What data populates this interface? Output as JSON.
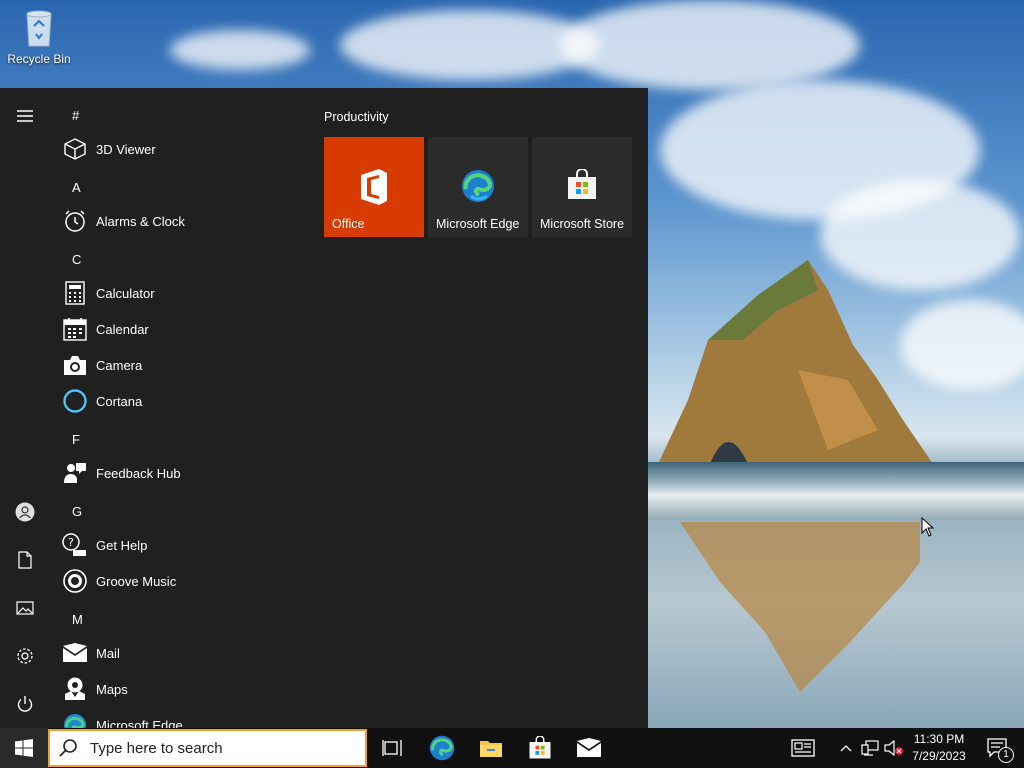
{
  "desktop": {
    "icons": [
      {
        "label": "Recycle Bin",
        "icon": "recycle-bin-icon"
      }
    ]
  },
  "start_menu": {
    "rail": [
      {
        "name": "menu-icon"
      },
      {
        "name": "user-icon"
      },
      {
        "name": "documents-icon"
      },
      {
        "name": "pictures-icon"
      },
      {
        "name": "settings-icon"
      },
      {
        "name": "power-icon"
      }
    ],
    "groups": [
      {
        "letter": "#"
      },
      {
        "letter": "A"
      },
      {
        "letter": "C"
      },
      {
        "letter": "F"
      },
      {
        "letter": "G"
      },
      {
        "letter": "M"
      }
    ],
    "apps": [
      {
        "label": "3D Viewer",
        "icon": "cube-icon"
      },
      {
        "label": "Alarms & Clock",
        "icon": "alarm-clock-icon"
      },
      {
        "label": "Calculator",
        "icon": "calculator-icon"
      },
      {
        "label": "Calendar",
        "icon": "calendar-icon"
      },
      {
        "label": "Camera",
        "icon": "camera-icon"
      },
      {
        "label": "Cortana",
        "icon": "cortana-icon"
      },
      {
        "label": "Feedback Hub",
        "icon": "feedback-icon"
      },
      {
        "label": "Get Help",
        "icon": "help-icon"
      },
      {
        "label": "Groove Music",
        "icon": "music-icon"
      },
      {
        "label": "Mail",
        "icon": "mail-icon"
      },
      {
        "label": "Maps",
        "icon": "maps-icon"
      },
      {
        "label": "Microsoft Edge",
        "icon": "edge-icon"
      }
    ],
    "tiles_group": "Productivity",
    "tiles": [
      {
        "label": "Office",
        "icon": "office-icon",
        "color": "#d83b01"
      },
      {
        "label": "Microsoft Edge",
        "icon": "edge-icon",
        "color": "#2b2b2b"
      },
      {
        "label": "Microsoft Store",
        "icon": "store-icon",
        "color": "#2b2b2b"
      }
    ]
  },
  "taskbar": {
    "search_placeholder": "Type here to search",
    "pinned": [
      "task-view-icon",
      "edge-icon",
      "file-explorer-icon",
      "store-icon",
      "mail-icon"
    ],
    "tray_icons": [
      "news-icon",
      "chevron-up-icon",
      "network-icon",
      "volume-muted-icon"
    ],
    "clock_time": "11:30 PM",
    "clock_date": "7/29/2023",
    "notification_count": "1"
  },
  "colors": {
    "accent": "#f0a030",
    "start_bg": "#202020",
    "taskbar_bg": "#101010",
    "office": "#d83b01"
  }
}
